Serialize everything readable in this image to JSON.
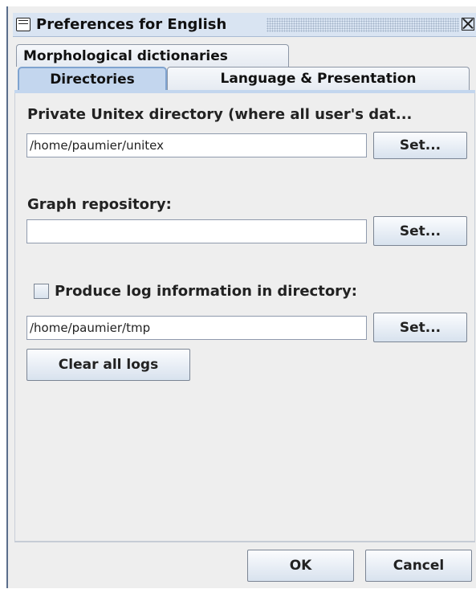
{
  "window": {
    "title": "Preferences for English"
  },
  "tabs": {
    "morphological_dictionaries": "Morphological dictionaries",
    "directories": "Directories",
    "language_presentation": "Language & Presentation"
  },
  "private_dir": {
    "label": "Private Unitex directory (where all user's dat...",
    "value": "/home/paumier/unitex",
    "set_label": "Set..."
  },
  "graph_repo": {
    "label": "Graph repository:",
    "value": "",
    "set_label": "Set..."
  },
  "log": {
    "checkbox_label": "Produce log information in directory:",
    "checked": false,
    "value": "/home/paumier/tmp",
    "set_label": "Set...",
    "clear_label": "Clear all logs"
  },
  "footer": {
    "ok_label": "OK",
    "cancel_label": "Cancel"
  }
}
